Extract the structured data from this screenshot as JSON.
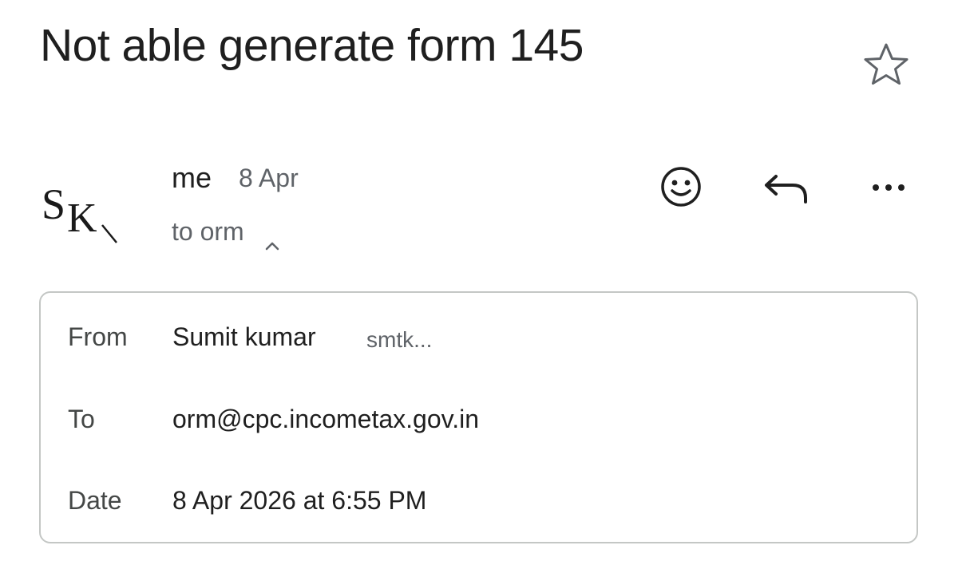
{
  "subject": "Not able generate form 145",
  "icons": {
    "star": "star-outline-icon",
    "emoji": "emoji-reaction-icon",
    "reply": "reply-icon",
    "more": "more-horizontal-icon",
    "chevron": "chevron-up-icon"
  },
  "sender": {
    "avatar_initials": "SK",
    "name": "me",
    "date_short": "8 Apr",
    "recipients_summary": "to orm"
  },
  "details": {
    "from_label": "From",
    "from_name": "Sumit kumar",
    "from_email_truncated": "smtk...",
    "to_label": "To",
    "to_value": "orm@cpc.incometax.gov.in",
    "date_label": "Date",
    "date_value": "8 Apr 2026 at 6:55 PM"
  },
  "colors": {
    "text_primary": "#1f1f1f",
    "text_secondary": "#5f6368",
    "border": "#c4c7c5"
  }
}
